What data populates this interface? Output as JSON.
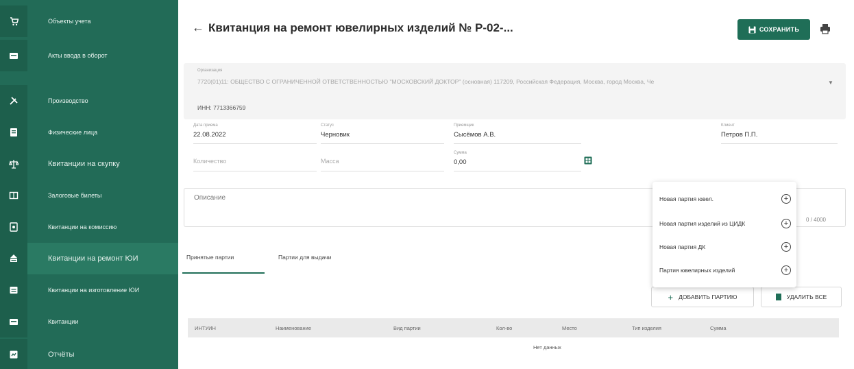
{
  "sidebar": {
    "items": [
      {
        "label": "Объекты учета",
        "icon": "cart-icon"
      },
      {
        "label": "Акты ввода в оборот",
        "icon": "document-icon"
      },
      {
        "label": "Производство",
        "icon": "tools-icon"
      },
      {
        "label": "Физические лица",
        "icon": "person-card-icon"
      },
      {
        "label": "Квитанции на скупку",
        "icon": "scales-icon"
      },
      {
        "label": "Залоговые билеты",
        "icon": "ticket-icon"
      },
      {
        "label": "Квитанции на комиссию",
        "icon": "commission-icon"
      },
      {
        "label": "Квитанции на ремонт ЮИ",
        "icon": "repair-icon"
      },
      {
        "label": "Квитанции на изготовление ЮИ",
        "icon": "manufacture-icon"
      },
      {
        "label": "Квитанции",
        "icon": "receipt-icon"
      },
      {
        "label": "Отчёты",
        "icon": "report-icon"
      }
    ]
  },
  "header": {
    "back_icon": "arrow-left-icon",
    "title": "Квитанция на ремонт ювелирных изделий № Р-02-...",
    "save_label": "СОХРАНИТЬ",
    "print_icon": "printer-icon"
  },
  "organization": {
    "label": "Организация",
    "value": "7720(01)11: ОБЩЕСТВО С ОГРАНИЧЕННОЙ ОТВЕТСТВЕННОСТЬЮ \"МОСКОВСКИЙ ДОКТОР\" (основная) 117209, Российская Федерация, Москва, город Москва, Че",
    "inn": "ИНН: 7713366759"
  },
  "fields": {
    "date": {
      "label": "Дата приема",
      "value": "22.08.2022"
    },
    "status": {
      "label": "Статус",
      "value": "Черновик"
    },
    "receiver": {
      "label": "Приемщик",
      "value": "Сысёмов А.В."
    },
    "client": {
      "label": "Клиент",
      "value": "Петров П.П."
    },
    "quantity": {
      "placeholder": "Количество"
    },
    "mass": {
      "placeholder": "Масса"
    },
    "sum": {
      "label": "Сумма",
      "value": "0,00"
    }
  },
  "description": {
    "label": "Описание",
    "counter": "0 / 4000"
  },
  "tabs": [
    {
      "label": "Принятые партии"
    },
    {
      "label": "Партии для выдачи"
    }
  ],
  "actions": {
    "add_label": "ДОБАВИТЬ ПАРТИЮ",
    "delete_label": "УДАЛИТЬ ВСЕ"
  },
  "table": {
    "columns": [
      "ИНТУИН",
      "Наименование",
      "Вид партии",
      "Кол-во",
      "Место",
      "Тип изделия",
      "Сумма"
    ],
    "empty_text": "Нет данных"
  },
  "menu": {
    "items": [
      {
        "label": "Новая партия ювел."
      },
      {
        "label": "Новая партия изделий из ЦИДК"
      },
      {
        "label": "Новая партия ДК"
      },
      {
        "label": "Партия ювелирных изделий"
      }
    ]
  }
}
